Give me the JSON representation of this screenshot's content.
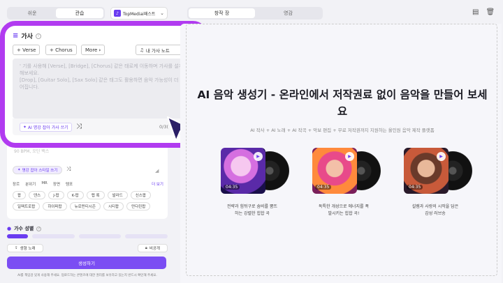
{
  "left": {
    "mode_tabs": [
      "쉬운",
      "관습"
    ],
    "model": "TopMediai패스트",
    "lyrics": {
      "title": "가사",
      "tag_buttons": [
        "+ Verse",
        "+ Chorus",
        "More"
      ],
      "notes_label": "내 가사 노트",
      "notes_count": "0",
      "placeholder": "' 기를 사용해 [Verse], [Bridge], [Chorus] 같은 태로케 이동하며 가사를 설계작성해보세요.\n[Drop], [Guitar Solo], [Sax Solo] 같은 태그도 활용하면 음악 가능성이 더 넓없어집니다.",
      "ai_button": "AI 명강 잡아 가사 쓰기",
      "char_count": "0/3("
    },
    "style": {
      "placeholder": "90 BPM, 오딘 백스",
      "ai_button": "명강 잡아 스타일 쓰기",
      "genre_tabs": [
        "장르",
        "분위기",
        "MR",
        "장면",
        "템포"
      ],
      "more": "더 보기",
      "chips": [
        "팝",
        "댄스",
        "J-팝",
        "K-팝",
        "랩 록",
        "발라드",
        "신스팝",
        "일렉트로팝",
        "하이퍼팝",
        "뉴로펀티시즌",
        "시티팝",
        "만다린팝"
      ]
    },
    "gender_label": "가수 성별",
    "mode_row": [
      "생형 노래",
      "비공개"
    ],
    "generate": "생성하기",
    "disclaimer": "AI를 책임감 있게 사용해 주세요. 업로드하는 콘텐츠에 대한 권리를 보유하고 있는지 반드시 확인해 주세요."
  },
  "right": {
    "tabs": [
      "창작 장",
      "영감"
    ],
    "title": "AI 음악 생성기 - 온라인에서 저작권료 없이 음악을 만들어 보세요",
    "subtitle": "AI 작사 + AI 노래 + AI 작곡 + 악보 편집 + 무료 저작권까지 지원하는 올인원 음악 제작 플랫폼",
    "cards": [
      {
        "duration": "04:35",
        "desc": "전략과 힘뒤구로 숨비를 뿜뜨\n하는 강렬한 힙합 곡"
      },
      {
        "duration": "04:35",
        "desc": "독특한 개성으로 에너지를 폭\n발시키는 힙합 곡!"
      },
      {
        "duration": "04:35",
        "desc": "설렘과 사랑의 시작을 담은\n감성 러브송"
      }
    ]
  },
  "colors": {
    "accent": "#7b4df3",
    "highlight": "#b13bf0"
  }
}
